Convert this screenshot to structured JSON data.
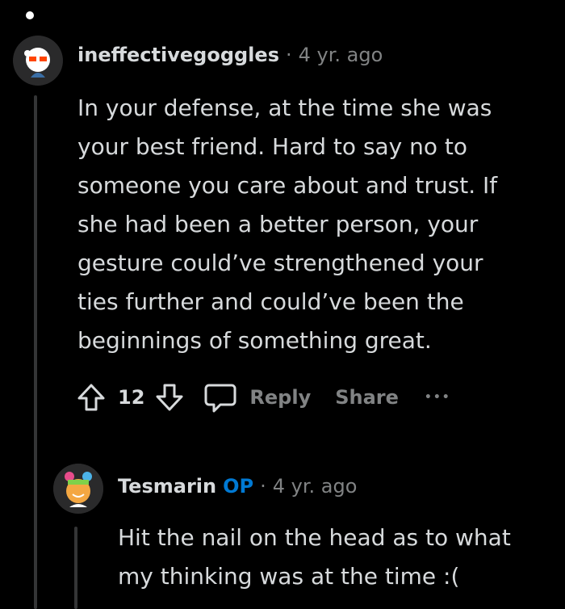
{
  "comments": [
    {
      "username": "ineffectivegoggles",
      "separator": "·",
      "timestamp": "4 yr. ago",
      "body_lines": [
        "In your defense, at the time she was",
        "your best friend. Hard to say no to",
        "someone you care about and trust. If",
        "she had been a better person, your",
        "gesture could’ve strengthened your",
        "ties further and could’ve been the",
        "beginnings of something great."
      ],
      "vote_count": "12",
      "reply_label": "Reply",
      "share_label": "Share",
      "more_label": "•••"
    },
    {
      "username": "Tesmarin",
      "op_badge": "OP",
      "separator": "·",
      "timestamp": "4 yr. ago",
      "body_lines": [
        "Hit the nail on the head as to what",
        "my thinking was at the time :("
      ]
    }
  ],
  "colors": {
    "background": "#000000",
    "text": "#d7dadc",
    "muted": "#818384",
    "op": "#0079d3",
    "thread_line": "#343536"
  }
}
